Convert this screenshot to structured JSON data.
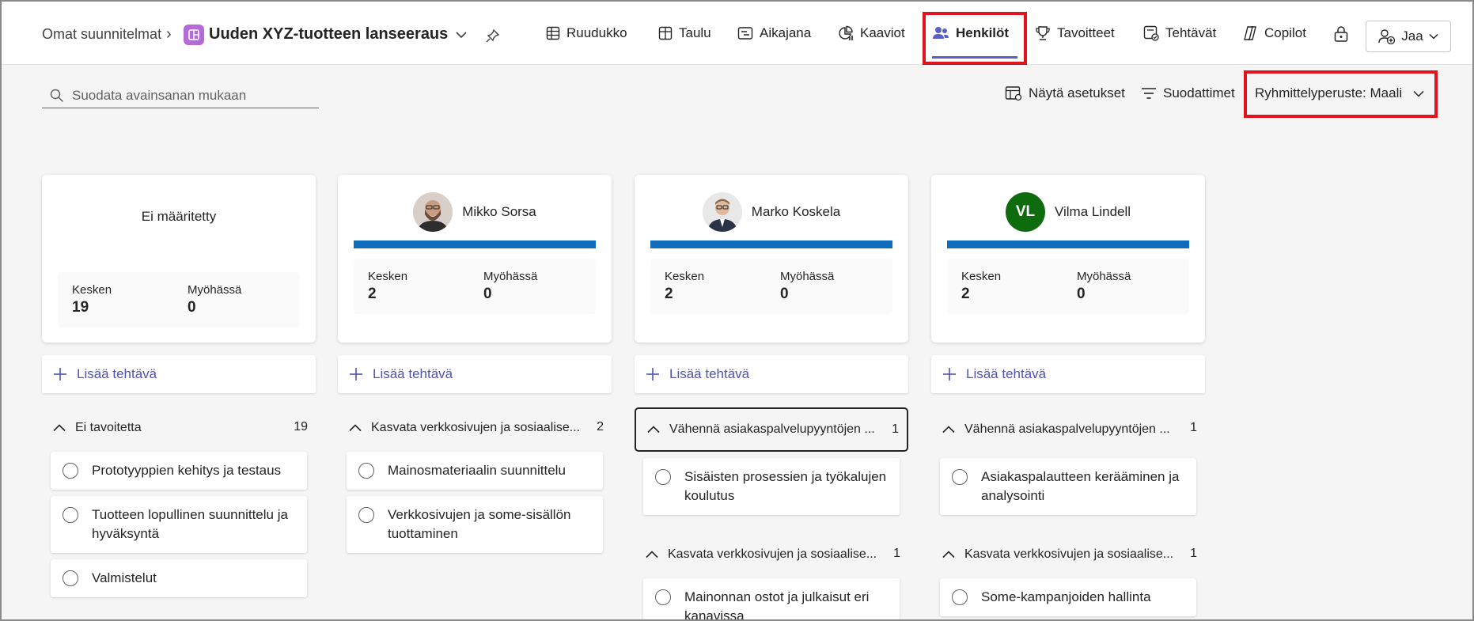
{
  "breadcrumb": {
    "root": "Omat suunnitelmat",
    "plan_title": "Uuden XYZ-tuotteen lanseeraus"
  },
  "tabs": [
    {
      "label": "Ruudukko",
      "icon": "grid-icon"
    },
    {
      "label": "Taulu",
      "icon": "board-icon"
    },
    {
      "label": "Aikajana",
      "icon": "timeline-icon"
    },
    {
      "label": "Kaaviot",
      "icon": "charts-icon"
    },
    {
      "label": "Henkilöt",
      "icon": "people-icon",
      "active": true
    },
    {
      "label": "Tavoitteet",
      "icon": "trophy-icon"
    },
    {
      "label": "Tehtävät",
      "icon": "tasks-icon"
    },
    {
      "label": "Copilot",
      "icon": "copilot-icon"
    }
  ],
  "share": {
    "label": "Jaa"
  },
  "search": {
    "placeholder": "Suodata avainsanan mukaan"
  },
  "toolbar": {
    "show_settings": "Näytä asetukset",
    "filters": "Suodattimet",
    "group_by": "Ryhmittelyperuste: Maali"
  },
  "colors": {
    "accent": "#5b5fc7",
    "progress": "#0f6cbd",
    "highlight": "#e0131f",
    "avatar_vl": "#0e6b0e"
  },
  "columns": [
    {
      "name": "Ei määritetty",
      "avatar": null,
      "stats": {
        "in_progress_label": "Kesken",
        "in_progress": "19",
        "late_label": "Myöhässä",
        "late": "0"
      },
      "add_task": "Lisää tehtävä",
      "groups": [
        {
          "title": "Ei tavoitetta",
          "count": "19",
          "tasks": [
            "Prototyyppien kehitys ja testaus",
            "Tuotteen lopullinen suunnittelu ja hyväksyntä",
            "Valmistelut"
          ]
        }
      ]
    },
    {
      "name": "Mikko Sorsa",
      "avatar": "photo",
      "stats": {
        "in_progress_label": "Kesken",
        "in_progress": "2",
        "late_label": "Myöhässä",
        "late": "0"
      },
      "add_task": "Lisää tehtävä",
      "groups": [
        {
          "title": "Kasvata verkkosivujen ja sosiaalise...",
          "count": "2",
          "tasks": [
            "Mainosmateriaalin suunnittelu",
            "Verkkosivujen ja some-sisällön tuottaminen"
          ]
        }
      ]
    },
    {
      "name": "Marko Koskela",
      "avatar": "photo",
      "stats": {
        "in_progress_label": "Kesken",
        "in_progress": "2",
        "late_label": "Myöhässä",
        "late": "0"
      },
      "add_task": "Lisää tehtävä",
      "groups": [
        {
          "title": "Vähennä asiakaspalvelupyyntöjen ...",
          "count": "1",
          "tasks": [
            "Sisäisten prosessien ja työkalujen koulutus"
          ]
        },
        {
          "title": "Kasvata verkkosivujen ja sosiaalise...",
          "count": "1",
          "tasks": [
            "Mainonnan ostot ja julkaisut eri kanavissa"
          ]
        }
      ]
    },
    {
      "name": "Vilma Lindell",
      "avatar": "VL",
      "stats": {
        "in_progress_label": "Kesken",
        "in_progress": "2",
        "late_label": "Myöhässä",
        "late": "0"
      },
      "add_task": "Lisää tehtävä",
      "groups": [
        {
          "title": "Vähennä asiakaspalvelupyyntöjen ...",
          "count": "1",
          "tasks": [
            "Asiakaspalautteen kerääminen ja analysointi"
          ]
        },
        {
          "title": "Kasvata verkkosivujen ja sosiaalise...",
          "count": "1",
          "tasks": [
            "Some-kampanjoiden hallinta"
          ]
        }
      ]
    }
  ]
}
